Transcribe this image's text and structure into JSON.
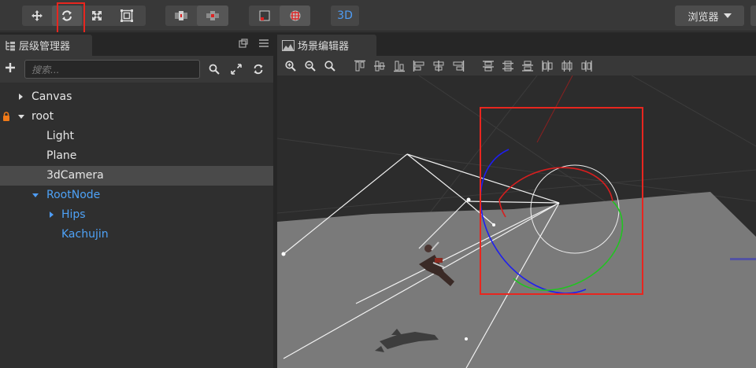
{
  "toolbar": {
    "transform_tools": [
      {
        "name": "move-icon"
      },
      {
        "name": "rotate-icon"
      },
      {
        "name": "scale-icon"
      },
      {
        "name": "rect-icon"
      }
    ],
    "pivot_tools": [
      {
        "name": "pivot-icon"
      },
      {
        "name": "global-icon"
      }
    ],
    "mode_tools": [
      {
        "name": "local-mode-icon"
      },
      {
        "name": "global-mode-icon"
      }
    ],
    "mode_3d_label": "3D",
    "browser_label": "浏览器",
    "highlight_color": "#e8261f"
  },
  "hierarchy": {
    "tab_label": "层级管理器",
    "search_placeholder": "搜索...",
    "items": [
      {
        "label": "Canvas",
        "expanded": false
      },
      {
        "label": "root",
        "expanded": true,
        "locked": true
      },
      {
        "label": "Light"
      },
      {
        "label": "Plane"
      },
      {
        "label": "3dCamera",
        "selected": true
      },
      {
        "label": "RootNode",
        "expanded": true
      },
      {
        "label": "Hips",
        "expanded": false
      },
      {
        "label": "Kachujin"
      }
    ]
  },
  "scene": {
    "tab_label": "场景编辑器",
    "tools": [
      "zoom-in-icon",
      "zoom-out-icon",
      "zoom-reset-icon",
      "align-top-icon",
      "align-vcenter-icon",
      "align-bottom-icon",
      "align-hcenter-left-icon",
      "align-right-icon",
      "align-left-icon",
      "distribute-top-icon",
      "distribute-vcenter-icon",
      "distribute-bottom-icon",
      "distribute-left-icon",
      "distribute-hcenter-icon",
      "distribute-right-icon"
    ],
    "colors": {
      "gizmo_x": "#d81e1e",
      "gizmo_y": "#22c322",
      "gizmo_z": "#1e1ef0",
      "plane": "#7a7a7a",
      "blue_text": "#4ea2f7"
    }
  }
}
